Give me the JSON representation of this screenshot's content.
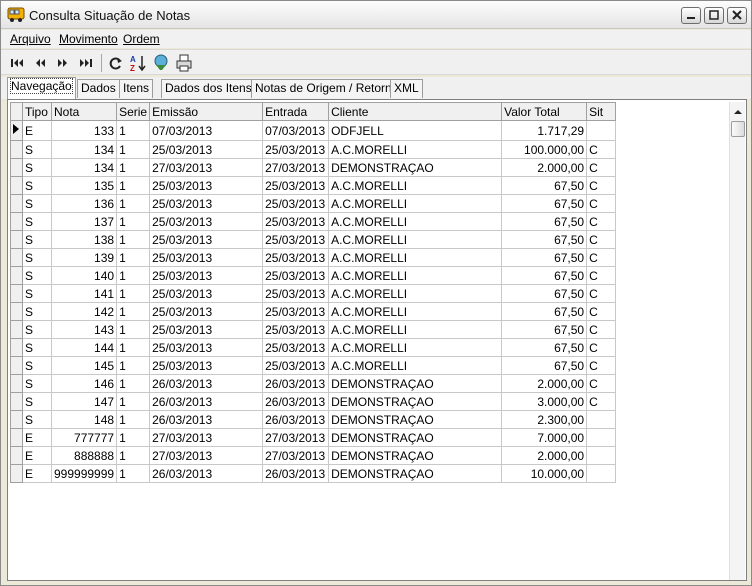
{
  "window": {
    "title": "Consulta Situação de Notas"
  },
  "menu": [
    {
      "label": "Arquivo",
      "underline_index": 0
    },
    {
      "label": "Movimento",
      "underline_index": 0
    },
    {
      "label": "Ordem",
      "underline_index": 0
    }
  ],
  "toolbar": [
    {
      "icon": "first-record-icon"
    },
    {
      "icon": "previous-record-icon"
    },
    {
      "icon": "next-record-icon"
    },
    {
      "icon": "last-record-icon"
    },
    {
      "icon": "refresh-icon"
    },
    {
      "icon": "sort-az-icon"
    },
    {
      "icon": "filter-icon"
    },
    {
      "icon": "print-icon"
    }
  ],
  "tabs": [
    {
      "label": "Navegação",
      "active": true
    },
    {
      "label": "Dados"
    },
    {
      "label": "Itens"
    },
    {
      "label": "Dados dos Itens"
    },
    {
      "label": "Notas de Origem / Retorno"
    },
    {
      "label": "XML"
    }
  ],
  "grid": {
    "columns": [
      "Tipo",
      "Nota",
      "Serie",
      "Emissão",
      "Entrada",
      "Cliente",
      "Valor Total",
      "Sit"
    ],
    "rows": [
      [
        "E",
        "133",
        "1",
        "07/03/2013",
        "07/03/2013",
        "ODFJELL",
        "1.717,29",
        ""
      ],
      [
        "S",
        "134",
        "1",
        "25/03/2013",
        "25/03/2013",
        "A.C.MORELLI",
        "100.000,00",
        "C"
      ],
      [
        "S",
        "134",
        "1",
        "27/03/2013",
        "27/03/2013",
        "DEMONSTRAÇAO",
        "2.000,00",
        "C"
      ],
      [
        "S",
        "135",
        "1",
        "25/03/2013",
        "25/03/2013",
        "A.C.MORELLI",
        "67,50",
        "C"
      ],
      [
        "S",
        "136",
        "1",
        "25/03/2013",
        "25/03/2013",
        "A.C.MORELLI",
        "67,50",
        "C"
      ],
      [
        "S",
        "137",
        "1",
        "25/03/2013",
        "25/03/2013",
        "A.C.MORELLI",
        "67,50",
        "C"
      ],
      [
        "S",
        "138",
        "1",
        "25/03/2013",
        "25/03/2013",
        "A.C.MORELLI",
        "67,50",
        "C"
      ],
      [
        "S",
        "139",
        "1",
        "25/03/2013",
        "25/03/2013",
        "A.C.MORELLI",
        "67,50",
        "C"
      ],
      [
        "S",
        "140",
        "1",
        "25/03/2013",
        "25/03/2013",
        "A.C.MORELLI",
        "67,50",
        "C"
      ],
      [
        "S",
        "141",
        "1",
        "25/03/2013",
        "25/03/2013",
        "A.C.MORELLI",
        "67,50",
        "C"
      ],
      [
        "S",
        "142",
        "1",
        "25/03/2013",
        "25/03/2013",
        "A.C.MORELLI",
        "67,50",
        "C"
      ],
      [
        "S",
        "143",
        "1",
        "25/03/2013",
        "25/03/2013",
        "A.C.MORELLI",
        "67,50",
        "C"
      ],
      [
        "S",
        "144",
        "1",
        "25/03/2013",
        "25/03/2013",
        "A.C.MORELLI",
        "67,50",
        "C"
      ],
      [
        "S",
        "145",
        "1",
        "25/03/2013",
        "25/03/2013",
        "A.C.MORELLI",
        "67,50",
        "C"
      ],
      [
        "S",
        "146",
        "1",
        "26/03/2013",
        "26/03/2013",
        "DEMONSTRAÇAO",
        "2.000,00",
        "C"
      ],
      [
        "S",
        "147",
        "1",
        "26/03/2013",
        "26/03/2013",
        "DEMONSTRAÇAO",
        "3.000,00",
        "C"
      ],
      [
        "S",
        "148",
        "1",
        "26/03/2013",
        "26/03/2013",
        "DEMONSTRAÇAO",
        "2.300,00",
        ""
      ],
      [
        "E",
        "777777",
        "1",
        "27/03/2013",
        "27/03/2013",
        "DEMONSTRAÇAO",
        "7.000,00",
        ""
      ],
      [
        "E",
        "888888",
        "1",
        "27/03/2013",
        "27/03/2013",
        "DEMONSTRAÇAO",
        "2.000,00",
        ""
      ],
      [
        "E",
        "999999999",
        "1",
        "26/03/2013",
        "26/03/2013",
        "DEMONSTRAÇAO",
        "10.000,00",
        ""
      ]
    ],
    "current_row": 0
  }
}
